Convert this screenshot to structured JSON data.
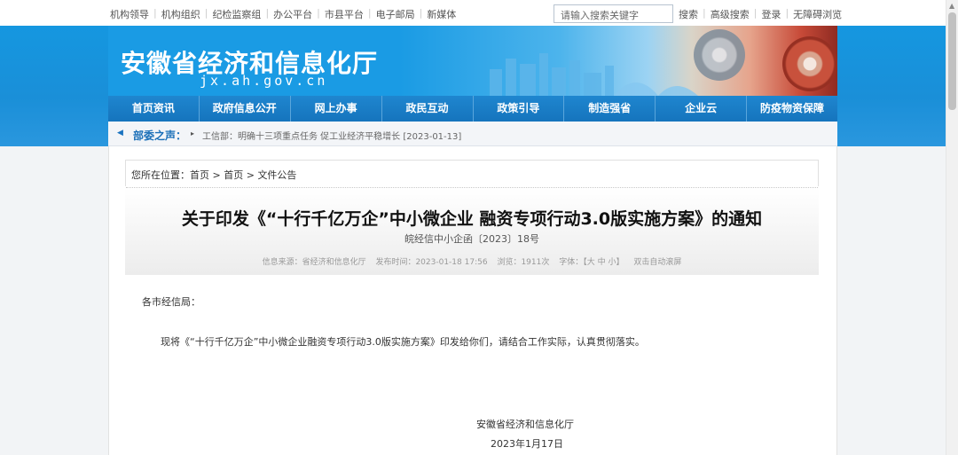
{
  "topbar": {
    "links": [
      "机构领导",
      "机构组织",
      "纪检监察组",
      "办公平台",
      "市县平台",
      "电子邮局",
      "新媒体"
    ],
    "search_placeholder": "请输入搜索关键字",
    "right_links": [
      "搜索",
      "高级搜索",
      "登录",
      "无障碍浏览"
    ]
  },
  "header": {
    "title": "安徽省经济和信息化厅",
    "domain": "jx.ah.gov.cn"
  },
  "nav": {
    "items": [
      "首页资讯",
      "政府信息公开",
      "网上办事",
      "政民互动",
      "政策引导",
      "制造强省",
      "企业云",
      "防疫物资保障"
    ]
  },
  "ticker": {
    "label": "部委之声：",
    "text": "工信部：明确十三项重点任务 促工业经济平稳增长 [2023-01-13]"
  },
  "breadcrumb": {
    "prefix": "您所在位置：",
    "items": [
      "首页",
      "首页",
      "文件公告"
    ],
    "separator": " > "
  },
  "article": {
    "title": "关于印发《“十行千亿万企”中小微企业 融资专项行动3.0版实施方案》的通知",
    "doc_number": "皖经信中小企函〔2023〕18号",
    "meta": {
      "source": "信息来源：省经济和信息化厅",
      "published": "发布时间：2023-01-18 17:56",
      "views": "浏览：1911次",
      "font_label": "字体：【",
      "font_large": "大",
      "font_medium": "中",
      "font_small": "小",
      "font_close": "】",
      "autoscroll": "双击自动滚屏"
    },
    "addressee": "各市经信局：",
    "body": "现将《“十行千亿万企”中小微企业融资专项行动3.0版实施方案》印发给你们，请结合工作实际，认真贯彻落实。",
    "signature_org": "安徽省经济和信息化厅",
    "signature_date": "2023年1月17日"
  }
}
